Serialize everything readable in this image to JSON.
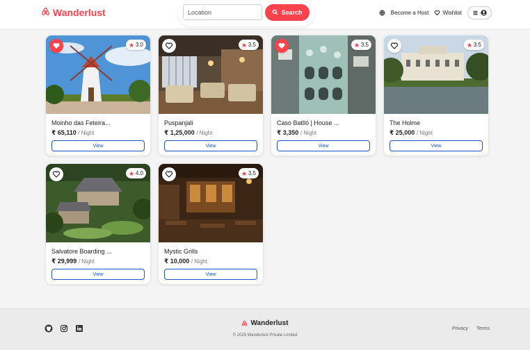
{
  "navbar": {
    "brand": "Wanderlust",
    "search_placeholder": "Location",
    "search_button": "Search",
    "become_host": "Become a Host",
    "wishlist": "Wishlist"
  },
  "colors": {
    "accent": "#fe424d",
    "link_blue": "#1a55c9"
  },
  "listings": [
    {
      "title": "Moinho das Feteira...",
      "price": "₹ 65,110",
      "per": "/ Night",
      "rating": "3.0",
      "liked": true,
      "view_label": "View"
    },
    {
      "title": "Puspanjali",
      "price": "₹ 1,25,000",
      "per": "/ Night",
      "rating": "3.5",
      "liked": false,
      "view_label": "View"
    },
    {
      "title": "Caso Batlló | House ...",
      "price": "₹ 3,350",
      "per": "/ Night",
      "rating": "3.5",
      "liked": true,
      "view_label": "View"
    },
    {
      "title": "The Holme",
      "price": "₹ 25,000",
      "per": "/ Night",
      "rating": "3.5",
      "liked": false,
      "view_label": "View"
    },
    {
      "title": "Salvatore Boarding ...",
      "price": "₹ 29,999",
      "per": "/ Night",
      "rating": "4.0",
      "liked": false,
      "view_label": "View"
    },
    {
      "title": "Mystic Grills",
      "price": "₹ 10,000",
      "per": "/ Night",
      "rating": "3.5",
      "liked": false,
      "view_label": "View"
    }
  ],
  "footer": {
    "brand": "Wanderlust",
    "copyright": "© 2025 Wanderlust Private Limited",
    "privacy": "Privacy",
    "terms": "Terms",
    "socials": [
      "github-icon",
      "instagram-icon",
      "linkedin-icon"
    ]
  }
}
